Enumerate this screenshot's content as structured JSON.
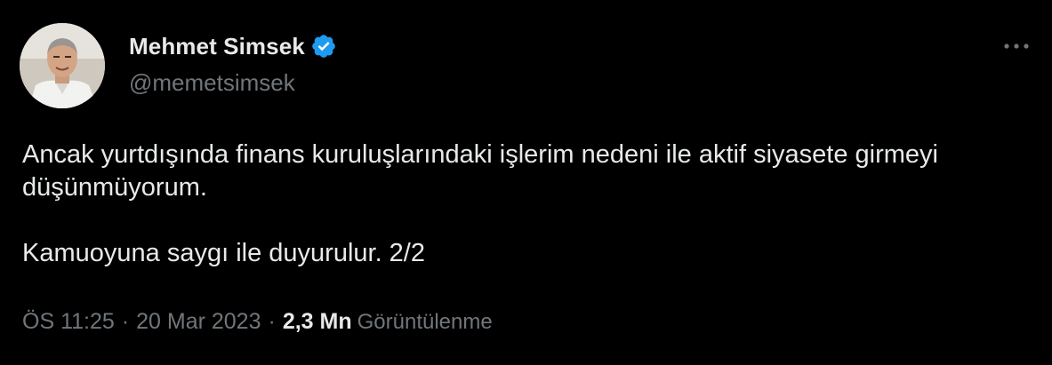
{
  "author": {
    "display_name": "Mehmet Simsek",
    "handle": "@memetsimsek",
    "verified": true
  },
  "tweet": {
    "text": "Ancak yurtdışında finans kuruluşlarındaki işlerim nedeni ile aktif siyasete girmeyi düşünmüyorum.\n\nKamuoyuna saygı ile duyurulur. 2/2",
    "time": "ÖS 11:25",
    "date": "20 Mar 2023",
    "separator": "·",
    "views_count": "2,3 Mn",
    "views_label": "Görüntülenme"
  },
  "icons": {
    "verified": "verified-badge-icon",
    "more": "more-horizontal-icon"
  },
  "colors": {
    "background": "#000000",
    "primary_text": "#e7e9ea",
    "secondary_text": "#71767b",
    "verified_blue": "#1d9bf0"
  }
}
